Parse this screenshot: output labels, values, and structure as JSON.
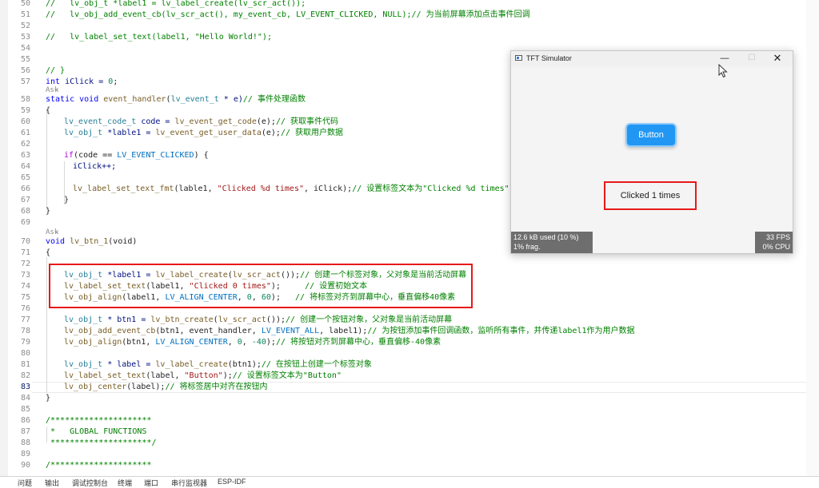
{
  "editor": {
    "current_line": "83",
    "codelens": "Ask",
    "lines": {
      "l50": {
        "num": "50",
        "p1": "//   lv_obj_t *label1 = lv_label_create(lv_scr_act());"
      },
      "l51": {
        "num": "51",
        "p1": "//   lv_obj_add_event_cb(lv_scr_act(), my_event_cb, LV_EVENT_CLICKED, NULL);// 为当前屏幕添加点击事件回调"
      },
      "l52": {
        "num": "52"
      },
      "l53": {
        "num": "53",
        "p1": "//   lv_label_set_text(label1, \"Hello World!\");"
      },
      "l54": {
        "num": "54"
      },
      "l55": {
        "num": "55"
      },
      "l56": {
        "num": "56",
        "p1": "// }"
      },
      "l57": {
        "num": "57",
        "p1": "int",
        "p2": " iClick = ",
        "p3": "0",
        "p4": ";"
      },
      "l58": {
        "num": "58",
        "p1": "static",
        "p2": " void",
        "p3": " event_handler",
        "p4": "(",
        "p5": "lv_event_t",
        "p6": " * e)",
        "p7": "// 事件处理函数"
      },
      "l59": {
        "num": "59",
        "p1": "{"
      },
      "l60": {
        "num": "60",
        "p1": "lv_event_code_t",
        "p2": " code = ",
        "p3": "lv_event_get_code",
        "p4": "(e);",
        "p5": "// 获取事件代码"
      },
      "l61": {
        "num": "61",
        "p1": "lv_obj_t",
        "p2": " *lable1 = ",
        "p3": "lv_event_get_user_data",
        "p4": "(e);",
        "p5": "// 获取用户数据"
      },
      "l62": {
        "num": "62"
      },
      "l63": {
        "num": "63",
        "p1": "if",
        "p2": "(code == ",
        "p3": "LV_EVENT_CLICKED",
        "p4": ") {"
      },
      "l64": {
        "num": "64",
        "p1": "iClick++;"
      },
      "l65": {
        "num": "65"
      },
      "l66": {
        "num": "66",
        "p1": "lv_label_set_text_fmt",
        "p2": "(lable1, ",
        "p3": "\"Clicked %d times\"",
        "p4": ", iClick);",
        "p5": "// 设置标签文本为\"Clicked %d times\""
      },
      "l67": {
        "num": "67",
        "p1": "}"
      },
      "l68": {
        "num": "68",
        "p1": "}"
      },
      "l69": {
        "num": "69"
      },
      "l70": {
        "num": "70",
        "p1": "void",
        "p2": " lv_btn_1",
        "p3": "(void)"
      },
      "l71": {
        "num": "71",
        "p1": "{"
      },
      "l72": {
        "num": "72"
      },
      "l73": {
        "num": "73",
        "p1": "lv_obj_t",
        "p2": " *label1 = ",
        "p3": "lv_label_create",
        "p4": "(",
        "p5": "lv_scr_act",
        "p6": "());",
        "p7": "// 创建一个标签对象，父对象是当前活动屏幕"
      },
      "l74": {
        "num": "74",
        "p1": "lv_label_set_text",
        "p2": "(label1, ",
        "p3": "\"Clicked 0 times\"",
        "p4": ");     ",
        "p5": "// 设置初始文本"
      },
      "l75": {
        "num": "75",
        "p1": "lv_obj_align",
        "p2": "(label1, ",
        "p3": "LV_ALIGN_CENTER",
        "p4": ", ",
        "p5": "0",
        "p6": ", ",
        "p7": "60",
        "p8": ");   ",
        "p9": "// 将标签对齐到屏幕中心，垂直偏移40像素"
      },
      "l76": {
        "num": "76"
      },
      "l77": {
        "num": "77",
        "p1": "lv_obj_t",
        "p2": " * btn1 = ",
        "p3": "lv_btn_create",
        "p4": "(",
        "p5": "lv_scr_act",
        "p6": "());",
        "p7": "// 创建一个按钮对象，父对象是当前活动屏幕"
      },
      "l78": {
        "num": "78",
        "p1": "lv_obj_add_event_cb",
        "p2": "(btn1, event_handler, ",
        "p3": "LV_EVENT_ALL",
        "p4": ", label1);",
        "p5": "// 为按钮添加事件回调函数，监听所有事件，并传递label1作为用户数据"
      },
      "l79": {
        "num": "79",
        "p1": "lv_obj_align",
        "p2": "(btn1, ",
        "p3": "LV_ALIGN_CENTER",
        "p4": ", ",
        "p5": "0",
        "p6": ", ",
        "p7": "-40",
        "p8": ");",
        "p9": "// 将按钮对齐到屏幕中心，垂直偏移-40像素"
      },
      "l80": {
        "num": "80"
      },
      "l81": {
        "num": "81",
        "p1": "lv_obj_t",
        "p2": " * label = ",
        "p3": "lv_label_create",
        "p4": "(btn1);",
        "p5": "// 在按钮上创建一个标签对象"
      },
      "l82": {
        "num": "82",
        "p1": "lv_label_set_text",
        "p2": "(label, ",
        "p3": "\"Button\"",
        "p4": ");",
        "p5": "// 设置标签文本为\"Button\""
      },
      "l83": {
        "num": "83",
        "p1": "lv_obj_center",
        "p2": "(label);",
        "p3": "// 将标签居中对齐在按钮内"
      },
      "l84": {
        "num": "84",
        "p1": "}"
      },
      "l85": {
        "num": "85"
      },
      "l86": {
        "num": "86",
        "p1": "/*********************"
      },
      "l87": {
        "num": "87",
        "p1": " *   GLOBAL FUNCTIONS"
      },
      "l88": {
        "num": "88",
        "p1": " *********************/"
      },
      "l89": {
        "num": "89"
      },
      "l90": {
        "num": "90",
        "p1": "/*********************"
      }
    }
  },
  "panel_tabs": [
    "问题",
    "输出",
    "调试控制台",
    "终端",
    "端口",
    "串行监视器",
    "ESP-IDF"
  ],
  "simulator": {
    "title": "TFT Simulator",
    "min": "—",
    "max": "☐",
    "close": "✕",
    "button_label": "Button",
    "label_text": "Clicked 1 times",
    "mem_used": "12.6 kB used (10 %)",
    "frag": "1% frag.",
    "fps": "33 FPS",
    "cpu": "0% CPU"
  }
}
